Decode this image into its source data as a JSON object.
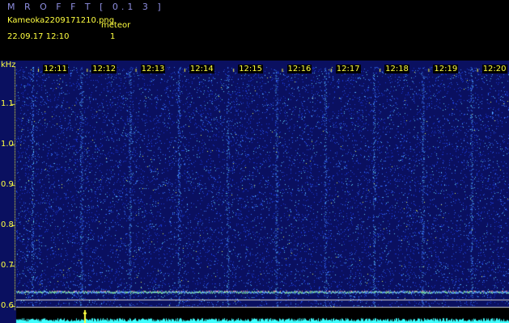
{
  "header": {
    "app_title": "M R O F F T  [ 0.1 3 ]",
    "file_name": "Kameoka2209171210.png",
    "meteor_label": "meteor",
    "date_time": "22.09.17  12:10",
    "meteor_count": "1"
  },
  "chart_data": {
    "type": "heatmap",
    "title": "",
    "ylabel": "kHz",
    "yticks": [
      "1.1",
      "1.0",
      "0.9",
      "0.8",
      "0.7",
      "0.6"
    ],
    "xticks": [
      "12:11",
      "12:12",
      "12:13",
      "12:14",
      "12:15",
      "12:16",
      "12:17",
      "12:18",
      "12:19",
      "12:20"
    ],
    "ylim": [
      0.58,
      1.17
    ],
    "background_color": "#0a1060",
    "noise_colors": [
      "#1a3ad8",
      "#3f7cff",
      "#5fd0ff",
      "#e0ff60"
    ],
    "trace_color": "#40ffff",
    "meteor_color": "#ffff40"
  }
}
